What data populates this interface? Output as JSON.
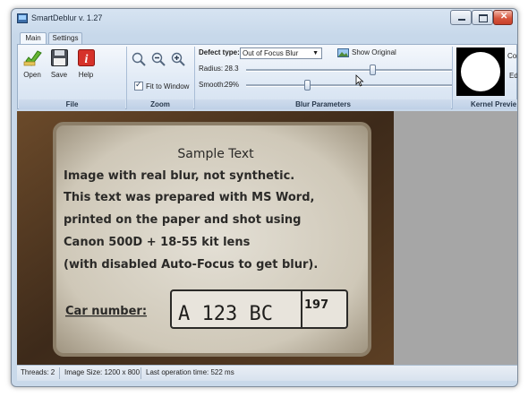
{
  "window": {
    "title": "SmartDeblur v. 1.27"
  },
  "tabs": [
    "Main",
    "Settings"
  ],
  "file_group": {
    "label": "File",
    "buttons": [
      {
        "label": "Open",
        "icon": "open-check-icon"
      },
      {
        "label": "Save",
        "icon": "floppy-disk-icon"
      },
      {
        "label": "Help",
        "icon": "help-info-icon"
      }
    ]
  },
  "zoom_group": {
    "label": "Zoom",
    "icons": [
      "zoom-icon",
      "zoom-out-icon",
      "zoom-in-icon"
    ],
    "fit_to_window": {
      "label": "Fit to Window",
      "checked": true
    }
  },
  "blur_group": {
    "label": "Blur Parameters",
    "defect_type_label": "Defect type:",
    "defect_type_value": "Out of Focus Blur",
    "show_original_label": "Show Original",
    "radius_label": "Radius:",
    "radius_value": "28.3",
    "smooth_label": "Smooth:",
    "smooth_value": "29%",
    "radius_fraction": 0.62,
    "smooth_fraction": 0.29
  },
  "kernel_group": {
    "label": "Kernel Previe",
    "side_labels": [
      "Corre",
      "Edge"
    ]
  },
  "image": {
    "lines": [
      "Sample Text",
      "Image with real blur, not synthetic.",
      "This text was prepared with MS Word,",
      "printed on the paper and shot using",
      "Canon 500D + 18-55 kit lens",
      "(with disabled Auto-Focus to get blur)."
    ],
    "car_number_label": "Car number:",
    "plate_main": "A 123 BC",
    "plate_region": "197"
  },
  "status": {
    "threads": "Threads: 2",
    "image_size": "Image Size: 1200 x 800",
    "last_time": "Last operation time: 522 ms"
  },
  "colors": {
    "ribbon_bg": "#dfe9f5",
    "paper": "#d9d3c3",
    "frame": "#5a4128",
    "workspace": "#a6a6a6"
  }
}
